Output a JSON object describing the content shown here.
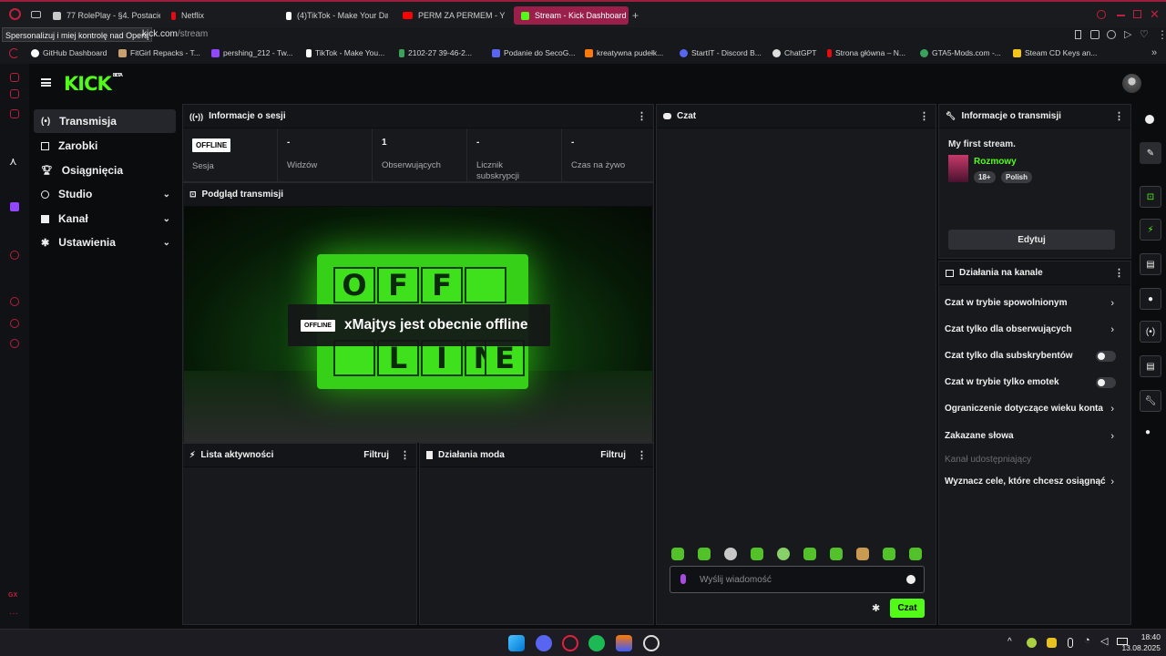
{
  "browser": {
    "tabs": [
      {
        "label": "77 RolePlay - §4. Postacie",
        "color": "#c9c9c9"
      },
      {
        "label": "Netflix",
        "color": "#e50914"
      },
      {
        "label": "(4)TikTok - Make Your Da",
        "color": "#ffffff"
      },
      {
        "label": "PERM ZA PERMEM - You",
        "color": "#ff0000"
      },
      {
        "label": "Stream - Kick Dashboard",
        "color": "#53fc18"
      }
    ],
    "tooltip": "Spersonalizuj i miej kontrolę nad Operą",
    "url_host": "kick.com",
    "url_path": "/stream",
    "bookmarks": [
      {
        "label": "GitHub Dashboard",
        "color": "#ffffff"
      },
      {
        "label": "FitGirl Repacks - T...",
        "color": "#c8a070"
      },
      {
        "label": "pershing_212 - Tw...",
        "color": "#9146ff"
      },
      {
        "label": "TikTok - Make You...",
        "color": "#ffffff"
      },
      {
        "label": "2102-27 39-46-2...",
        "color": "#3aa35a"
      },
      {
        "label": "Podanie do SecoG...",
        "color": "#5865f2"
      },
      {
        "label": "kreatywna pudełk...",
        "color": "#ff7a00"
      },
      {
        "label": "StartIT - Discord B...",
        "color": "#5865f2"
      },
      {
        "label": "ChatGPT",
        "color": "#dddddd"
      },
      {
        "label": "Strona główna – N...",
        "color": "#e50914"
      },
      {
        "label": "GTA5-Mods.com -...",
        "color": "#3aa35a"
      },
      {
        "label": "Steam CD Keys an...",
        "color": "#f5c518"
      }
    ]
  },
  "kick": {
    "logo": "KICK",
    "logo_sup": "BETA",
    "accent": "#53fc18",
    "nav": [
      {
        "label": "Transmisja",
        "icon": "broadcast-icon"
      },
      {
        "label": "Zarobki",
        "icon": "earnings-icon"
      },
      {
        "label": "Osiągnięcia",
        "icon": "trophy-icon"
      },
      {
        "label": "Studio",
        "icon": "studio-icon"
      },
      {
        "label": "Kanał",
        "icon": "channel-icon"
      },
      {
        "label": "Ustawienia",
        "icon": "gear-icon"
      }
    ],
    "session": {
      "title": "Informacje o sesji",
      "stats": [
        {
          "value": "OFFLINE",
          "label": "Sesja"
        },
        {
          "value": "-",
          "label": "Widzów"
        },
        {
          "value": "1",
          "label": "Obserwujących"
        },
        {
          "value": "-",
          "label": "Licznik subskrypcji"
        },
        {
          "value": "-",
          "label": "Czas na żywo"
        }
      ]
    },
    "preview": {
      "title": "Podgląd transmisji",
      "badge": "OFFLINE",
      "message": "xMajtys jest obecnie offline",
      "letters_top": [
        "O",
        "F",
        "F",
        ""
      ],
      "letters_bottom": [
        "",
        "L",
        "I",
        "N",
        "E"
      ]
    },
    "activity": {
      "title": "Lista aktywności",
      "filter": "Filtruj"
    },
    "mod_actions": {
      "title": "Działania moda",
      "filter": "Filtruj"
    },
    "chat": {
      "title": "Czat",
      "placeholder": "Wyślij wiadomość",
      "send": "Czat"
    },
    "stream_info": {
      "title": "Informacje o transmisji",
      "stream_title": "My first stream.",
      "category": "Rozmowy",
      "tags": [
        "18+",
        "Polish"
      ],
      "edit": "Edytuj"
    },
    "channel_actions": {
      "title": "Działania na kanale",
      "items": [
        {
          "label": "Czat w trybie spowolnionym",
          "control": "chevron"
        },
        {
          "label": "Czat tylko dla obserwujących",
          "control": "chevron"
        },
        {
          "label": "Czat tylko dla subskrybentów",
          "control": "toggle",
          "on": false
        },
        {
          "label": "Czat w trybie tylko emotek",
          "control": "toggle",
          "on": false
        },
        {
          "label": "Ograniczenie dotyczące wieku konta",
          "control": "chevron"
        },
        {
          "label": "Zakazane słowa",
          "control": "chevron"
        },
        {
          "label": "Kanał udostępniający",
          "control": "disabled"
        },
        {
          "label": "Wyznacz cele, które chcesz osiągnąć",
          "control": "chevron"
        }
      ]
    }
  },
  "taskbar": {
    "time": "18:40",
    "date": "13.08.2025"
  }
}
